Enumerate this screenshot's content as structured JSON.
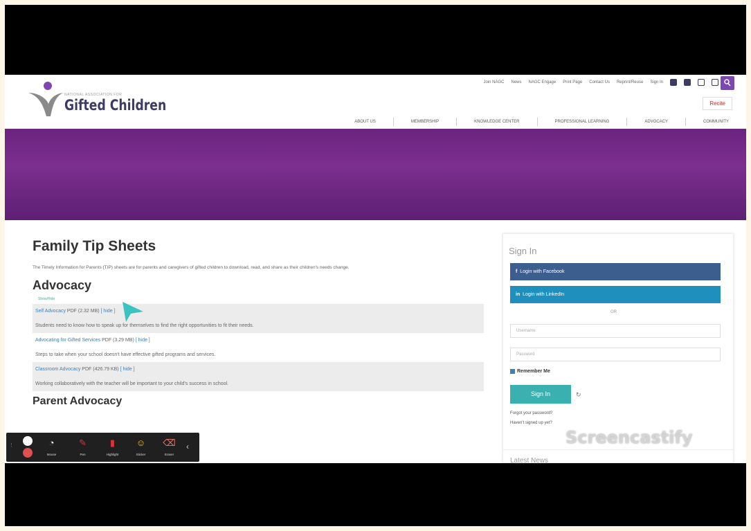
{
  "header": {
    "logo_tagline": "NATIONAL ASSOCIATION FOR",
    "logo_name": "Gifted Children",
    "top_links": [
      "Join NAGC",
      "News",
      "NAGC Engage",
      "Print Page",
      "Contact Us",
      "Reprint/Reuse",
      "Sign In"
    ],
    "recite_label": "Recite"
  },
  "nav": [
    "ABOUT US",
    "MEMBERSHIP",
    "KNOWLEDGE CENTER",
    "PROFESSIONAL LEARNING",
    "ADVOCACY",
    "COMMUNITY"
  ],
  "main": {
    "title": "Family Tip Sheets",
    "intro": "The Timely Information for Parents (TIP) sheets are for parents and caregivers of gifted children to download, read, and share as their children's needs change.",
    "section": "Advocacy",
    "small_link": "Show/Hide",
    "items": [
      {
        "link": "Self Advocacy",
        "meta": " PDF (2.32 MB)",
        "toggle": "[ hide ]",
        "desc": "Students need to know how to speak up for themselves to find the right opportunities to fit their needs."
      },
      {
        "link": "Advocating for Gifted Services",
        "meta": " PDF (3.29 MB)",
        "toggle": "[ hide ]",
        "desc": "Steps to take when your school doesn't have effective gifted programs and services."
      },
      {
        "link": "Classroom Advocacy",
        "meta": " PDF (426.79 KB)",
        "toggle": "[ hide ]",
        "desc": "Working collaboratively with the teacher will be important to your child's success in school."
      }
    ],
    "next_section": "Parent Advocacy"
  },
  "sidebar": {
    "title": "Sign In",
    "facebook": "Login with Facebook",
    "linkedin": "Login with LinkedIn",
    "or": "OR",
    "username_placeholder": "Username",
    "password_placeholder": "Password",
    "remember": "Remember Me",
    "signin": "Sign In",
    "forgot": "Forgot your password?",
    "signup": "Haven't signed up yet?",
    "latest": "Latest News"
  },
  "recorder": {
    "tools": [
      "Mouse",
      "Pen",
      "Highlight",
      "Sticker",
      "Eraser"
    ],
    "watermark": "Screencastify"
  },
  "colors": {
    "banner": "#6a237f",
    "facebook": "#3b5e8f",
    "linkedin": "#1f8fbd",
    "signin": "#3bb0b0",
    "link": "#3d7fb6"
  }
}
